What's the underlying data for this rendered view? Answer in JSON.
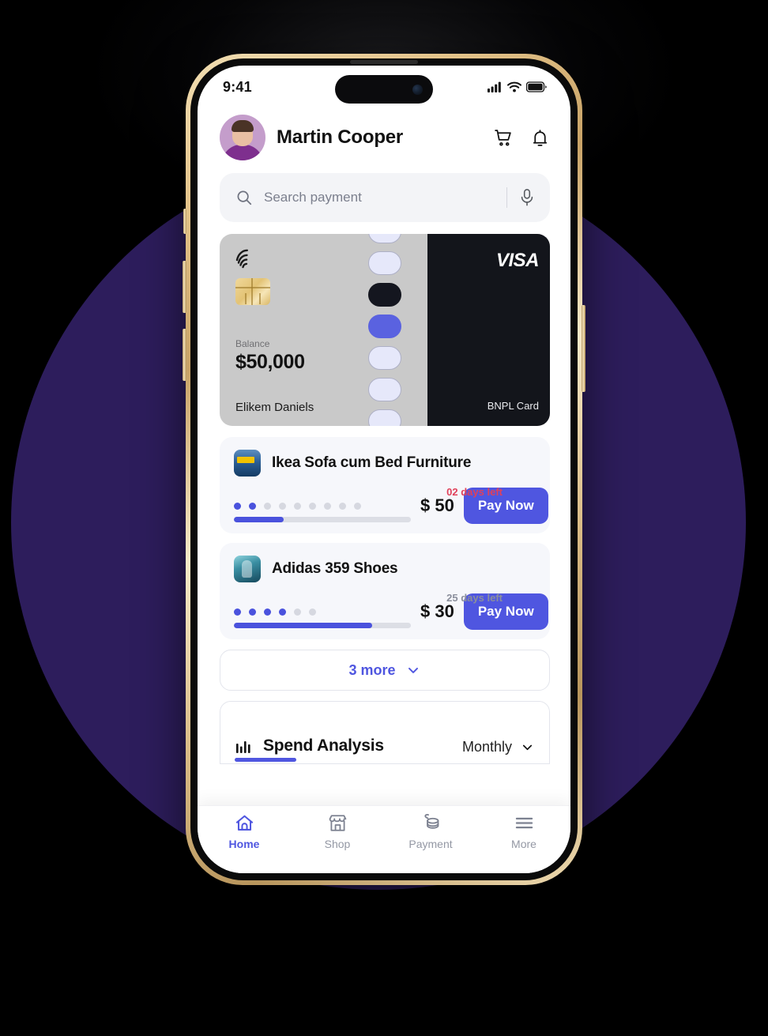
{
  "status_bar": {
    "time": "9:41",
    "icons": [
      "cellular-signal-icon",
      "wifi-icon",
      "battery-icon"
    ]
  },
  "header": {
    "user_name": "Martin Cooper",
    "avatar": "user-avatar",
    "actions": [
      {
        "name": "cart-icon",
        "label": "Cart"
      },
      {
        "name": "bell-icon",
        "label": "Notifications"
      }
    ]
  },
  "search": {
    "placeholder": "Search payment",
    "value": "",
    "search_icon": "search-icon",
    "mic_icon": "microphone-icon"
  },
  "card": {
    "balance_label": "Balance",
    "balance_value": "$50,000",
    "holder_name": "Elikem Daniels",
    "brand": "VISA",
    "card_type": "BNPL Card",
    "contactless_icon": "contactless-icon",
    "chip_icon": "chip-icon",
    "swatches": [
      "light",
      "light",
      "dark",
      "blue",
      "light",
      "light",
      "light",
      "light"
    ],
    "colors": {
      "card_face": "#c9c9c9",
      "card_dark": "#13151b",
      "swatch_light": "#e6e8fa",
      "swatch_dark": "#14161f",
      "swatch_blue": "#5a62e0"
    }
  },
  "payments": [
    {
      "title": "Ikea Sofa cum Bed Furniture",
      "thumb": "ikea-store-thumbnail",
      "days_left": "02 days left",
      "days_urgent": true,
      "installments_total": 9,
      "installments_paid": 2,
      "progress_percent": 28,
      "amount": "$ 50",
      "action_label": "Pay Now"
    },
    {
      "title": "Adidas 359 Shoes",
      "thumb": "adidas-shoes-thumbnail",
      "days_left": "25 days left",
      "days_urgent": false,
      "installments_total": 6,
      "installments_paid": 4,
      "progress_percent": 78,
      "amount": "$ 30",
      "action_label": "Pay Now"
    }
  ],
  "more_button": {
    "label": "3 more",
    "chevron": "chevron-down-icon"
  },
  "spend_analysis": {
    "title": "Spend Analysis",
    "icon": "bar-chart-icon",
    "period": "Monthly",
    "chevron": "chevron-down-icon"
  },
  "bottom_nav": {
    "items": [
      {
        "label": "Home",
        "icon": "home-icon",
        "active": true
      },
      {
        "label": "Shop",
        "icon": "shop-icon",
        "active": false
      },
      {
        "label": "Payment",
        "icon": "coins-icon",
        "active": false
      },
      {
        "label": "More",
        "icon": "menu-icon",
        "active": false
      }
    ]
  },
  "theme": {
    "accent": "#4f56e0",
    "urgent": "#e0415a",
    "background": "#000000",
    "circle": "#2d1d5c"
  }
}
